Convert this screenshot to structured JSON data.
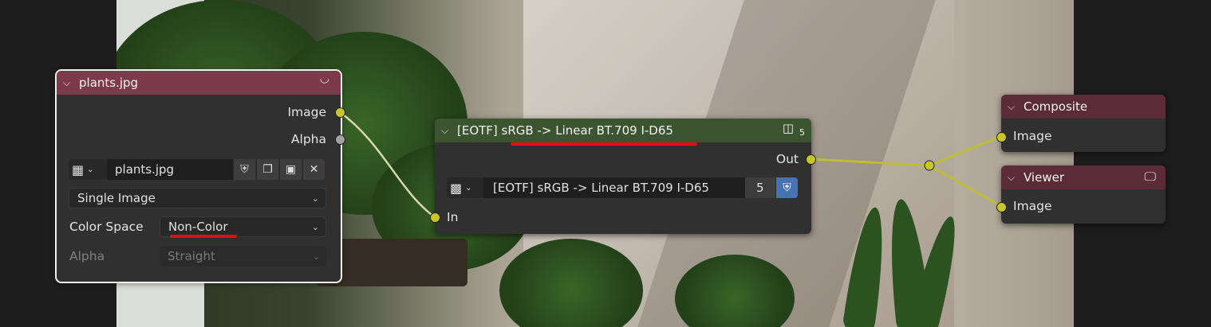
{
  "colors": {
    "image_node_header": "#7d3a4b",
    "group_node_header": "#3c5430",
    "output_node_header": "#5b2c37",
    "socket_color": "#c7c729",
    "wire_color": "#bdbd37",
    "annotation_red": "#e01010"
  },
  "image_node": {
    "title": "plants.jpg",
    "outputs": [
      "Image",
      "Alpha"
    ],
    "image_name": "plants.jpg",
    "icons": [
      "image-type-icon",
      "chevron-down-icon",
      "fake-user-shield-icon",
      "duplicate-icon",
      "open-folder-icon",
      "unlink-x-icon"
    ],
    "source": "Single Image",
    "color_space_label": "Color Space",
    "color_space_value": "Non-Color",
    "alpha_label": "Alpha",
    "alpha_value": "Straight"
  },
  "group_node": {
    "title": "[EOTF] sRGB -> Linear BT.709 I-D65",
    "users_badge": "5",
    "output_label": "Out",
    "input_label": "In",
    "group_name": "[EOTF] sRGB -> Linear BT.709 I-D65",
    "user_count": "5"
  },
  "composite_node": {
    "title": "Composite",
    "input_label": "Image"
  },
  "viewer_node": {
    "title": "Viewer",
    "input_label": "Image"
  }
}
